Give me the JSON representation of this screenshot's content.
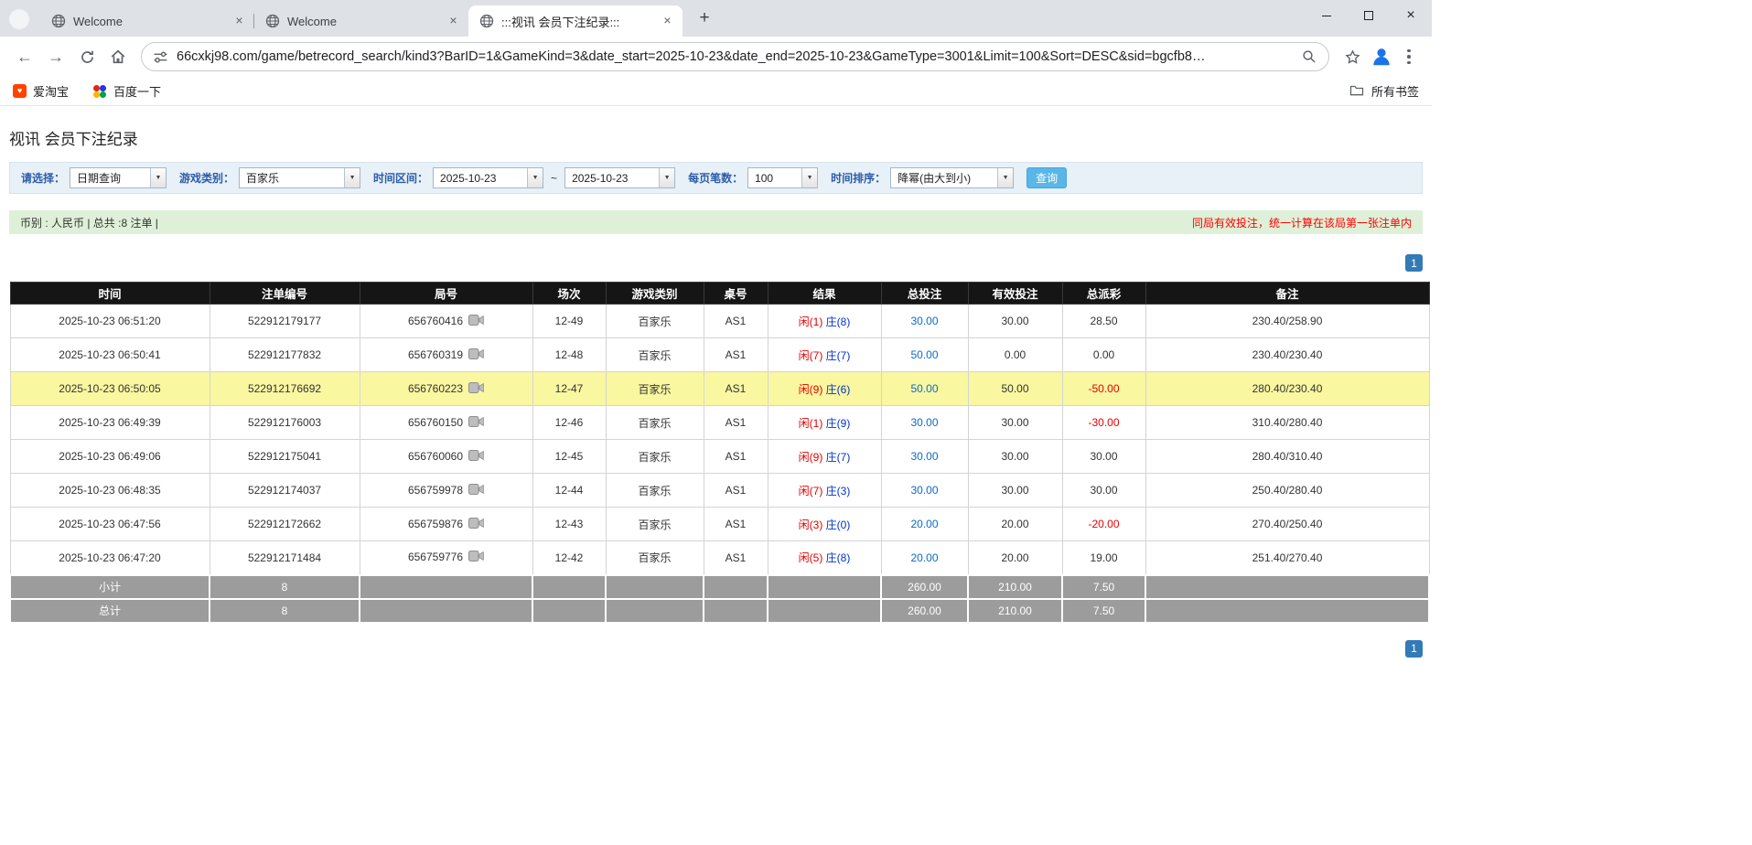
{
  "colors": {
    "accent_blue": "#337ab7",
    "highlight_row": "#faf7a1",
    "negative_red": "#e80000",
    "player_red": "#e00000",
    "banker_blue": "#0033cc",
    "link_blue": "#0a6aca",
    "summary_green": "#dff0d8",
    "header_black": "#151515"
  },
  "browser": {
    "tabs": [
      {
        "title": "Welcome"
      },
      {
        "title": "Welcome"
      },
      {
        "title": ":::视讯 会员下注纪录:::"
      }
    ],
    "url": "66cxkj98.com/game/betrecord_search/kind3?BarID=1&GameKind=3&date_start=2025-10-23&date_end=2025-10-23&GameType=3001&Limit=100&Sort=DESC&sid=bgcfb8…",
    "bookmarks": {
      "aitaobao": "爱淘宝",
      "baidu": "百度一下",
      "all_bookmarks": "所有书签"
    }
  },
  "page": {
    "title": "视讯 会员下注纪录",
    "filters": {
      "select_label": "请选择：",
      "select_value": "日期查询",
      "game_label": "游戏类别：",
      "game_value": "百家乐",
      "range_label": "时间区间：",
      "date_start": "2025-10-23",
      "range_sep": "~",
      "date_end": "2025-10-23",
      "per_page_label": "每页笔数：",
      "per_page_value": "100",
      "sort_label": "时间排序：",
      "sort_value": "降幂(由大到小)",
      "search_button": "查询"
    },
    "summary_bar": {
      "left": "币别 : 人民币 | 总共 :8 注单 |",
      "right": "同局有效投注，统一计算在该局第一张注单内"
    },
    "pagination": "1",
    "table": {
      "headers": [
        "时间",
        "注单编号",
        "局号",
        "场次",
        "游戏类别",
        "桌号",
        "结果",
        "总投注",
        "有效投注",
        "总派彩",
        "备注"
      ],
      "rows": [
        {
          "time": "2025-10-23 06:51:20",
          "bet_id": "522912179177",
          "round": "656760416",
          "session": "12-49",
          "game": "百家乐",
          "table_no": "AS1",
          "result_player": "闲(1)",
          "result_banker": "庄(8)",
          "total_bet": "30.00",
          "valid_bet": "30.00",
          "payout": "28.50",
          "note": "230.40/258.90",
          "highlight": false
        },
        {
          "time": "2025-10-23 06:50:41",
          "bet_id": "522912177832",
          "round": "656760319",
          "session": "12-48",
          "game": "百家乐",
          "table_no": "AS1",
          "result_player": "闲(7)",
          "result_banker": "庄(7)",
          "total_bet": "50.00",
          "valid_bet": "0.00",
          "payout": "0.00",
          "note": "230.40/230.40",
          "highlight": false
        },
        {
          "time": "2025-10-23 06:50:05",
          "bet_id": "522912176692",
          "round": "656760223",
          "session": "12-47",
          "game": "百家乐",
          "table_no": "AS1",
          "result_player": "闲(9)",
          "result_banker": "庄(6)",
          "total_bet": "50.00",
          "valid_bet": "50.00",
          "payout": "-50.00",
          "note": "280.40/230.40",
          "highlight": true
        },
        {
          "time": "2025-10-23 06:49:39",
          "bet_id": "522912176003",
          "round": "656760150",
          "session": "12-46",
          "game": "百家乐",
          "table_no": "AS1",
          "result_player": "闲(1)",
          "result_banker": "庄(9)",
          "total_bet": "30.00",
          "valid_bet": "30.00",
          "payout": "-30.00",
          "note": "310.40/280.40",
          "highlight": false
        },
        {
          "time": "2025-10-23 06:49:06",
          "bet_id": "522912175041",
          "round": "656760060",
          "session": "12-45",
          "game": "百家乐",
          "table_no": "AS1",
          "result_player": "闲(9)",
          "result_banker": "庄(7)",
          "total_bet": "30.00",
          "valid_bet": "30.00",
          "payout": "30.00",
          "note": "280.40/310.40",
          "highlight": false
        },
        {
          "time": "2025-10-23 06:48:35",
          "bet_id": "522912174037",
          "round": "656759978",
          "session": "12-44",
          "game": "百家乐",
          "table_no": "AS1",
          "result_player": "闲(7)",
          "result_banker": "庄(3)",
          "total_bet": "30.00",
          "valid_bet": "30.00",
          "payout": "30.00",
          "note": "250.40/280.40",
          "highlight": false
        },
        {
          "time": "2025-10-23 06:47:56",
          "bet_id": "522912172662",
          "round": "656759876",
          "session": "12-43",
          "game": "百家乐",
          "table_no": "AS1",
          "result_player": "闲(3)",
          "result_banker": "庄(0)",
          "total_bet": "20.00",
          "valid_bet": "20.00",
          "payout": "-20.00",
          "note": "270.40/250.40",
          "highlight": false
        },
        {
          "time": "2025-10-23 06:47:20",
          "bet_id": "522912171484",
          "round": "656759776",
          "session": "12-42",
          "game": "百家乐",
          "table_no": "AS1",
          "result_player": "闲(5)",
          "result_banker": "庄(8)",
          "total_bet": "20.00",
          "valid_bet": "20.00",
          "payout": "19.00",
          "note": "251.40/270.40",
          "highlight": false
        }
      ],
      "subtotal": {
        "label": "小计",
        "count": "8",
        "total_bet": "260.00",
        "valid_bet": "210.00",
        "payout": "7.50"
      },
      "total": {
        "label": "总计",
        "count": "8",
        "total_bet": "260.00",
        "valid_bet": "210.00",
        "payout": "7.50"
      }
    }
  }
}
